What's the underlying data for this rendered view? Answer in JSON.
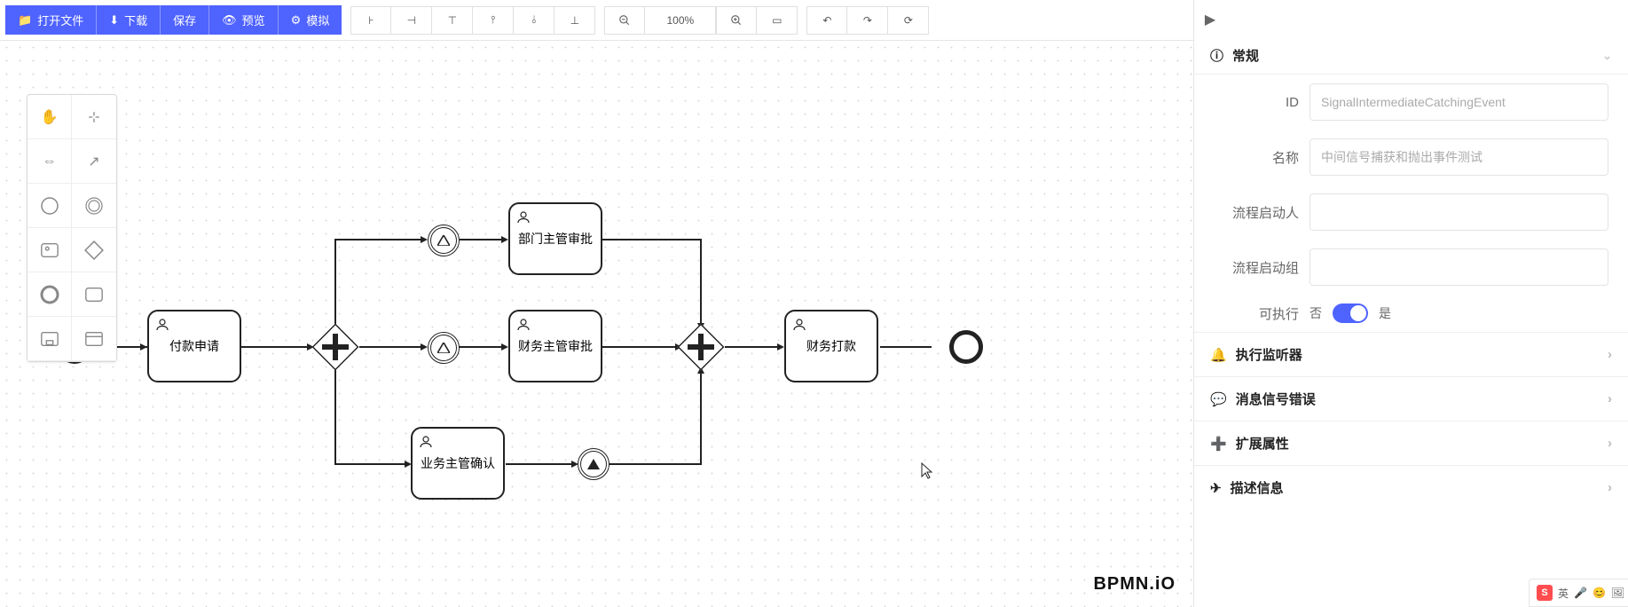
{
  "toolbar": {
    "open": "打开文件",
    "download": "下载",
    "save": "保存",
    "preview": "预览",
    "simulate": "模拟"
  },
  "zoom": {
    "percent": "100%"
  },
  "watermark": "BPMN.iO",
  "diagram": {
    "task1": "付款申请",
    "task2": "部门主管审批",
    "task3": "财务主管审批",
    "task4": "业务主管确认",
    "task5": "财务打款"
  },
  "panel": {
    "general_title": "常规",
    "id_label": "ID",
    "id_value": "SignalIntermediateCatchingEvent",
    "name_label": "名称",
    "name_value": "中间信号捕获和抛出事件测试",
    "starter_label": "流程启动人",
    "starter_group_label": "流程启动组",
    "executable_label": "可执行",
    "no": "否",
    "yes": "是",
    "sect_listener": "执行监听器",
    "sect_message": "消息信号错误",
    "sect_ext": "扩展属性",
    "sect_desc": "描述信息"
  },
  "ime": {
    "lang": "英"
  }
}
